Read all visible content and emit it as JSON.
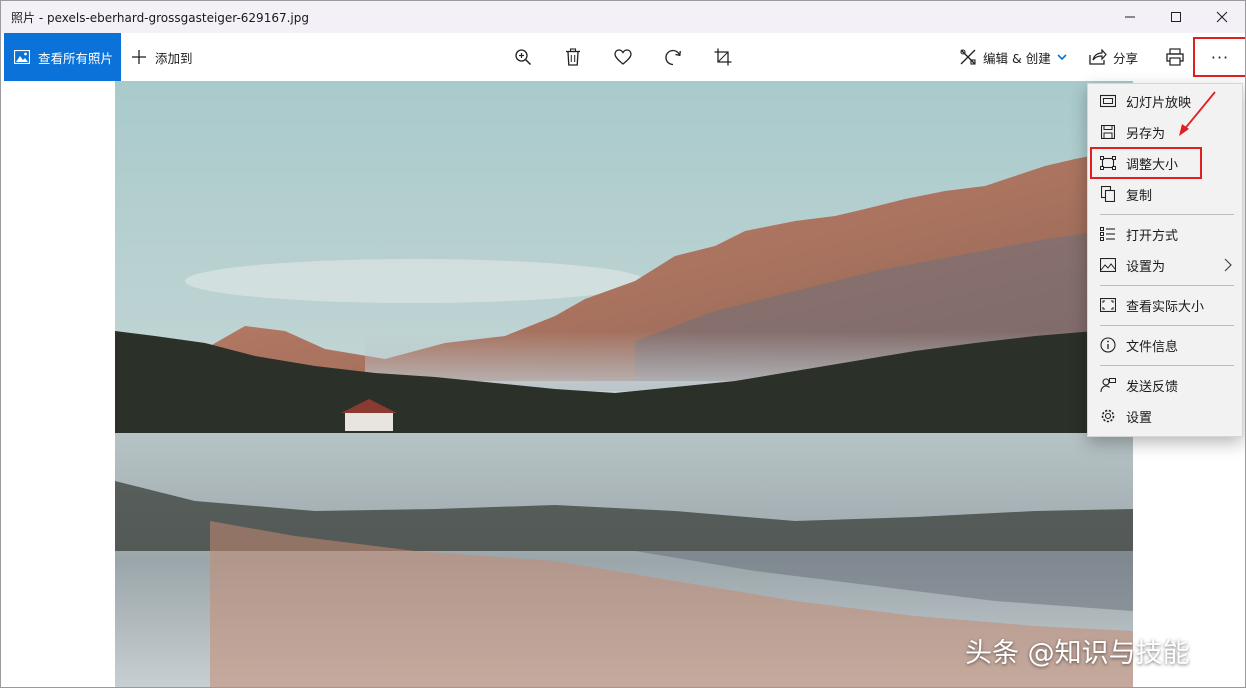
{
  "window": {
    "title": "照片 - pexels-eberhard-grossgasteiger-629167.jpg",
    "minimize_icon": "minimize-icon",
    "maximize_icon": "maximize-icon",
    "close_icon": "close-icon"
  },
  "toolbar": {
    "view_all_label": "查看所有照片",
    "add_to_label": "添加到",
    "tools": [
      "zoom-in-icon",
      "delete-icon",
      "favorite-icon",
      "rotate-icon",
      "crop-icon"
    ],
    "edit_create_label": "编辑 & 创建",
    "share_label": "分享",
    "more_label": "···"
  },
  "context_menu": {
    "items": [
      {
        "label": "幻灯片放映",
        "icon": "slideshow-icon"
      },
      {
        "label": "另存为",
        "icon": "save-icon"
      },
      {
        "label": "调整大小",
        "icon": "resize-icon",
        "highlighted": true
      },
      {
        "label": "复制",
        "icon": "copy-icon"
      },
      {
        "label": "打开方式",
        "icon": "open-with-icon"
      },
      {
        "label": "设置为",
        "icon": "set-as-icon",
        "has_submenu": true
      },
      {
        "label": "查看实际大小",
        "icon": "actual-size-icon"
      },
      {
        "label": "文件信息",
        "icon": "info-icon"
      },
      {
        "label": "发送反馈",
        "icon": "feedback-icon"
      },
      {
        "label": "设置",
        "icon": "settings-icon"
      }
    ]
  },
  "watermark": "头条 @知识与技能",
  "colors": {
    "accent": "#0a72d8",
    "annotation_red": "#e02020",
    "title_bar": "#f3f0f8",
    "menu_bg": "#f2f2f2"
  }
}
